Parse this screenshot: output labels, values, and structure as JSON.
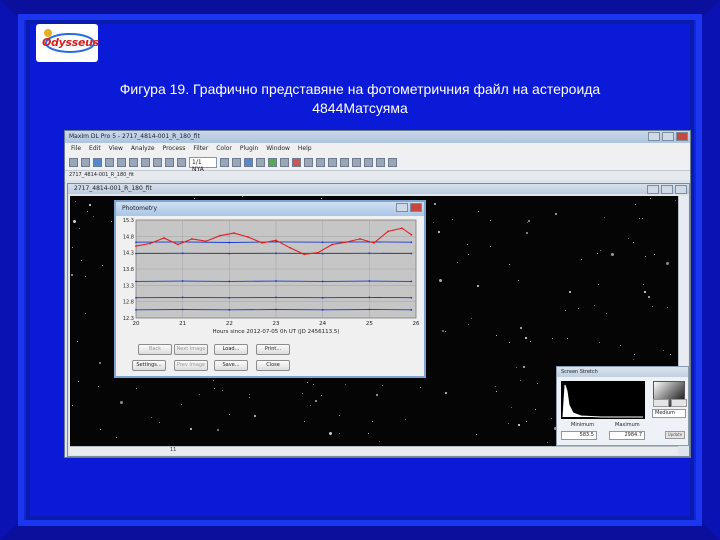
{
  "logo": {
    "text": "Odysseus",
    "icon": "planet-rings-logo"
  },
  "caption": {
    "line1": "Фигура 19. Графично представяне на фотометричния файл на астероида",
    "line2": "4844Матсуяма"
  },
  "app": {
    "title": "MaxIm DL Pro 5 - 2717_4814-001_R_180_fit",
    "menu": [
      "File",
      "Edit",
      "View",
      "Analyze",
      "Process",
      "Filter",
      "Color",
      "Plugin",
      "Window",
      "Help"
    ],
    "zoom": "1/1 NYA",
    "tab": "2717_4814-001_R_180_fit",
    "image_window_title": "2717_4814-001_R_180_fit",
    "scroll_readout": "11"
  },
  "photometry": {
    "title": "Photometry",
    "buttons": {
      "back": "Back",
      "next_image": "Next Image",
      "load": "Load...",
      "print": "Print...",
      "settings": "Settings...",
      "prev_image": "Prev Image",
      "save": "Save...",
      "close": "Close"
    }
  },
  "stretch": {
    "title": "Screen Stretch",
    "minimum_label": "Minimum",
    "maximum_label": "Maximum",
    "minimum_value": "583.5",
    "maximum_value": "2984.7",
    "mode": "Medium",
    "update": "Update"
  },
  "chart_data": {
    "type": "line",
    "title": "",
    "xlabel": "Hours since 2012-07-05 0h UT (JD 2456113.5)",
    "ylabel": "",
    "xlim": [
      20,
      26
    ],
    "ylim": [
      15.3,
      12.3
    ],
    "x_ticks": [
      "20",
      "21",
      "22",
      "23",
      "24",
      "25",
      "26"
    ],
    "y_ticks": [
      "12.3",
      "12.8",
      "13.3",
      "13.8",
      "14.3",
      "14.8",
      "15.3"
    ],
    "y_inverted": true,
    "grid": true,
    "series": [
      {
        "color": "#1a3acc",
        "x": [
          20,
          21,
          22,
          23,
          24,
          25,
          25.9
        ],
        "y": [
          12.55,
          12.56,
          12.55,
          12.56,
          12.55,
          12.56,
          12.55
        ]
      },
      {
        "color": "#1a3acc",
        "x": [
          20,
          21,
          22,
          23,
          24,
          25,
          25.9
        ],
        "y": [
          12.92,
          12.93,
          12.92,
          12.93,
          12.92,
          12.93,
          12.92
        ]
      },
      {
        "color": "#1a3acc",
        "x": [
          20,
          21,
          22,
          23,
          24,
          25,
          25.9
        ],
        "y": [
          13.42,
          13.43,
          13.42,
          13.43,
          13.42,
          13.43,
          13.42
        ]
      },
      {
        "color": "#1a3acc",
        "x": [
          20,
          21,
          22,
          23,
          24,
          25,
          25.9
        ],
        "y": [
          14.27,
          14.28,
          14.27,
          14.28,
          14.27,
          14.28,
          14.27
        ]
      },
      {
        "color": "#1a3acc",
        "x": [
          20,
          21,
          22,
          23,
          24,
          25,
          25.9
        ],
        "y": [
          14.62,
          14.63,
          14.61,
          14.63,
          14.62,
          14.63,
          14.62
        ]
      },
      {
        "color": "#e02020",
        "x": [
          20,
          20.3,
          20.6,
          20.9,
          21.2,
          21.5,
          21.8,
          22.1,
          22.4,
          22.7,
          23.0,
          23.3,
          23.6,
          23.9,
          24.2,
          24.5,
          24.8,
          25.1,
          25.4,
          25.7,
          25.9
        ],
        "y": [
          14.5,
          14.58,
          14.75,
          14.55,
          14.72,
          14.65,
          14.82,
          14.9,
          14.78,
          14.6,
          14.68,
          14.45,
          14.25,
          14.3,
          14.55,
          14.62,
          14.72,
          14.6,
          14.95,
          15.05,
          14.85
        ]
      }
    ]
  }
}
